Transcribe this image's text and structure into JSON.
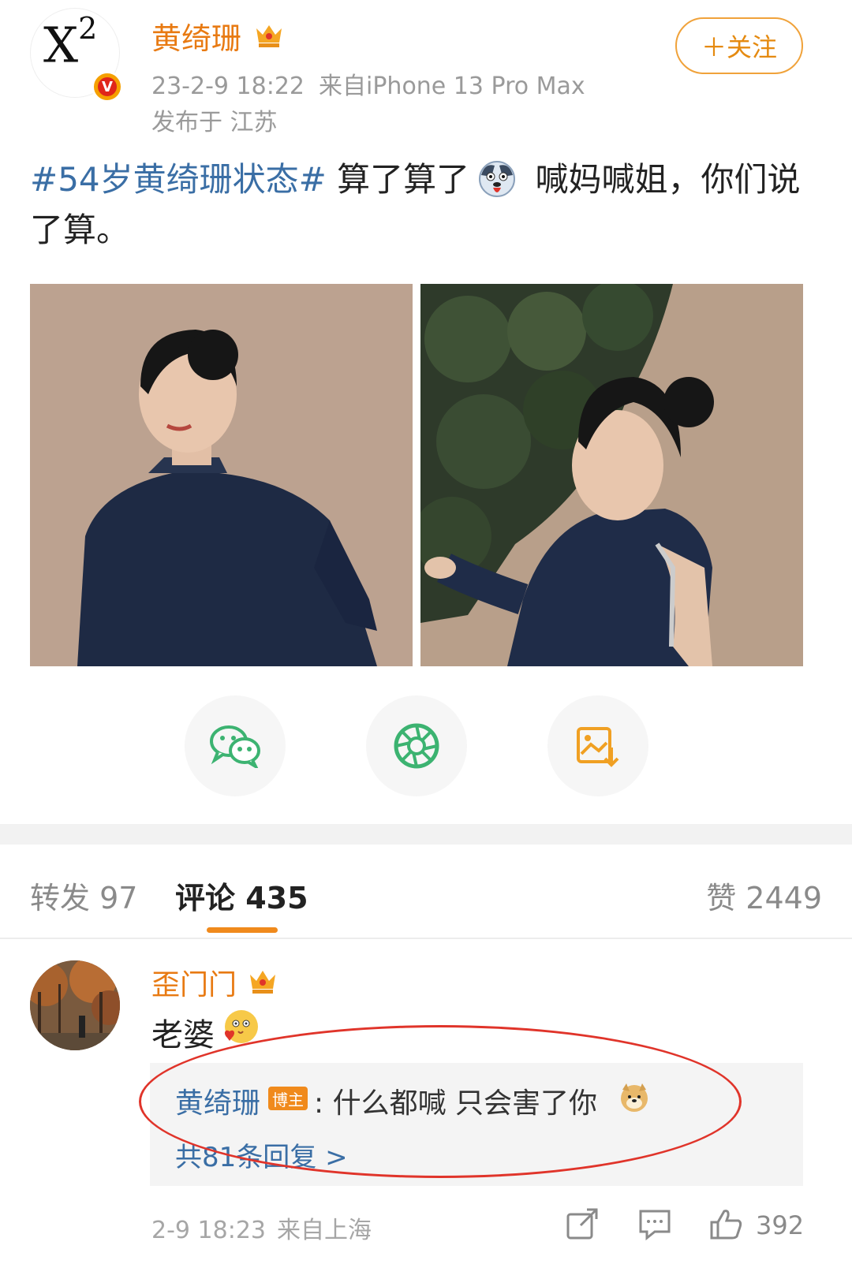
{
  "post": {
    "author_name": "黄绮珊",
    "avatar_text": "X",
    "avatar_sup": "2",
    "verified_icon": "v-badge-icon",
    "verified_letter": "V",
    "date": "23-2-9 18:22",
    "source": "来自iPhone 13 Pro Max",
    "location": "发布于 江苏",
    "follow_label": "＋关注",
    "hashtag": "#54岁黄绮珊状态#",
    "text_part1": " 算了算了",
    "text_part2": " 喊妈喊姐，你们说了算。",
    "inline_emoji": "dog-tongue-emoji",
    "images": [
      "photo-front-view",
      "photo-back-view"
    ]
  },
  "share": {
    "items": [
      "wechat-icon",
      "moments-icon",
      "save-image-icon"
    ]
  },
  "tabs": {
    "repost": "转发 97",
    "comments": "评论 435",
    "likes": "赞 2449"
  },
  "comment": {
    "user": "歪门门",
    "text": "老婆",
    "emoji": "heart-face-emoji",
    "reply": {
      "author": "黄绮珊",
      "badge": "博主",
      "text": ": 什么都喊 只会害了你",
      "emoji": "doge-emoji",
      "count_label": "共81条回复 >"
    },
    "date": "2-9 18:23",
    "source": "来自上海",
    "like_count": "392"
  },
  "colors": {
    "accent_orange": "#f08a1c",
    "link_blue": "#3a6ea5",
    "annotation_red": "#e0342a",
    "wechat_green": "#3cb371"
  }
}
